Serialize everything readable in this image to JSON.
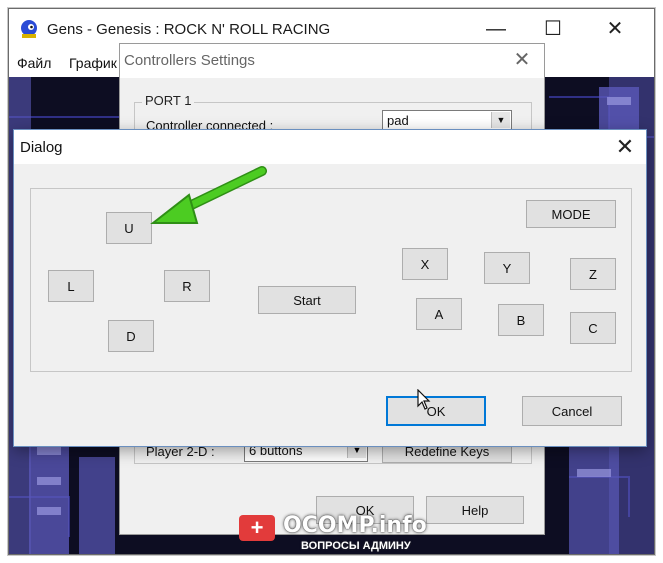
{
  "gens_window": {
    "title": "Gens - Genesis : ROCK N' ROLL RACING",
    "menu": [
      "Файл",
      "График"
    ],
    "controls": {
      "minimize": "—",
      "maximize": "☐",
      "close": "✕"
    }
  },
  "controllers_settings": {
    "title": "Controllers Settings",
    "close": "✕",
    "port_label": "PORT 1",
    "controller_connected_label": "Controller connected :",
    "controller_value": "pad",
    "player_label": "Player 2-D :",
    "player_value": "6 buttons",
    "redefine_label": "Redefine Keys",
    "ok_label": "OK",
    "help_label": "Help"
  },
  "dialog": {
    "title": "Dialog",
    "close": "✕",
    "buttons": {
      "up": "U",
      "left": "L",
      "right": "R",
      "down": "D",
      "start": "Start",
      "mode": "MODE",
      "x": "X",
      "y": "Y",
      "z": "Z",
      "a": "A",
      "b": "B",
      "c": "C"
    },
    "ok_label": "OK",
    "cancel_label": "Cancel"
  },
  "annotation": {
    "arrow_color": "#3fbf1f",
    "arrow_icon": "green-arrow-icon"
  },
  "watermark": {
    "badge": "+",
    "title": "OCOMP.info",
    "subtitle": "ВОПРОСЫ АДМИНУ"
  }
}
